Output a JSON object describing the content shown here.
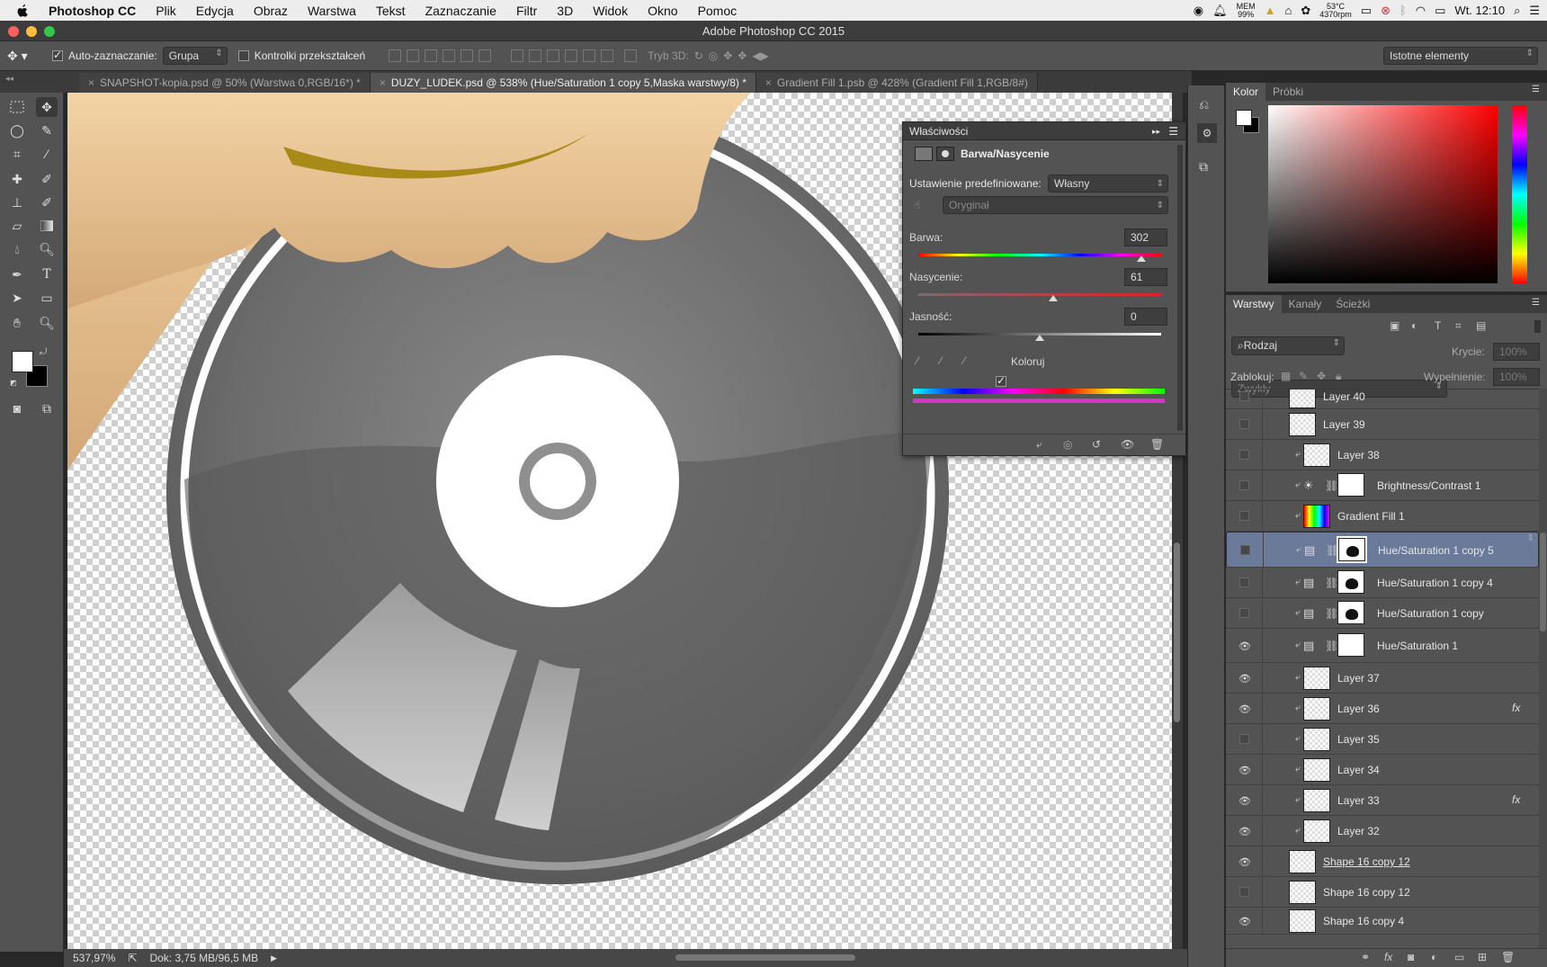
{
  "menubar": {
    "apple": "",
    "app_name": "Photoshop CC",
    "items": [
      "Plik",
      "Edycja",
      "Obraz",
      "Warstwa",
      "Tekst",
      "Zaznaczanie",
      "Filtr",
      "3D",
      "Widok",
      "Okno",
      "Pomoc"
    ],
    "mem_label": "MEM",
    "mem_value": "99%",
    "temp": "53°C",
    "rpm": "4370rpm",
    "clock": "Wt. 12:10"
  },
  "window": {
    "title": "Adobe Photoshop CC 2015"
  },
  "options": {
    "auto_select_label": "Auto-zaznaczanie:",
    "auto_select_value": "Grupa",
    "transform_controls_label": "Kontrolki przekształceń",
    "mode_3d_label": "Tryb 3D:",
    "workspace": "Istotne elementy"
  },
  "tabs": [
    {
      "label": "SNAPSHOT-kopia.psd @ 50% (Warstwa 0,RGB/16*) *",
      "active": false
    },
    {
      "label": "DUZY_LUDEK.psd @ 538% (Hue/Saturation 1 copy 5,Maska warstwy/8) *",
      "active": true
    },
    {
      "label": "Gradient Fill 1.psb @ 428% (Gradient Fill 1,RGB/8#)",
      "active": false
    }
  ],
  "status": {
    "zoom": "537,97%",
    "doc": "Dok: 3,75 MB/96,5 MB"
  },
  "properties": {
    "title": "Właściwości",
    "adjustment_name": "Barwa/Nasycenie",
    "preset_label": "Ustawienie predefiniowane:",
    "preset_value": "Własny",
    "channel_value": "Oryginał",
    "hue_label": "Barwa:",
    "hue_value": "302",
    "saturation_label": "Nasycenie:",
    "saturation_value": "61",
    "lightness_label": "Jasność:",
    "lightness_value": "0",
    "colorize_label": "Koloruj",
    "colorize_checked": true,
    "hue_fraction": 0.919,
    "saturation_fraction": 0.555,
    "lightness_fraction": 0.5
  },
  "color_panel": {
    "tabs": [
      "Kolor",
      "Próbki"
    ]
  },
  "layers_panel": {
    "tabs": [
      "Warstwy",
      "Kanały",
      "Ścieżki"
    ],
    "filter_value": "Rodzaj",
    "blend_mode": "Zwykły",
    "opacity_label": "Krycie:",
    "opacity_value": "100%",
    "lock_label": "Zablokuj:",
    "fill_label": "Wypełnienie:",
    "fill_value": "100%",
    "layers": [
      {
        "name": "Layer 40",
        "visible": false,
        "clipped": false,
        "kind": "pixel",
        "selected": false,
        "fx": false
      },
      {
        "name": "Layer 39",
        "visible": false,
        "clipped": false,
        "kind": "smart",
        "selected": false,
        "fx": false
      },
      {
        "name": "Layer 38",
        "visible": false,
        "clipped": true,
        "kind": "pixel",
        "selected": false,
        "fx": false
      },
      {
        "name": "Brightness/Contrast 1",
        "visible": false,
        "clipped": true,
        "kind": "brightness",
        "selected": false,
        "fx": false
      },
      {
        "name": "Gradient Fill 1",
        "visible": false,
        "clipped": true,
        "kind": "gradient",
        "selected": false,
        "fx": false
      },
      {
        "name": "Hue/Saturation 1 copy 5",
        "visible": false,
        "clipped": true,
        "kind": "huesat",
        "selected": true,
        "fx": false
      },
      {
        "name": "Hue/Saturation 1 copy 4",
        "visible": false,
        "clipped": true,
        "kind": "huesat",
        "selected": false,
        "fx": false
      },
      {
        "name": "Hue/Saturation 1 copy",
        "visible": false,
        "clipped": true,
        "kind": "huesat",
        "selected": false,
        "fx": false
      },
      {
        "name": "Hue/Saturation 1",
        "visible": true,
        "clipped": true,
        "kind": "huesat",
        "selected": false,
        "fx": false
      },
      {
        "name": "Layer 37",
        "visible": true,
        "clipped": true,
        "kind": "pixel",
        "selected": false,
        "fx": false
      },
      {
        "name": "Layer 36",
        "visible": true,
        "clipped": true,
        "kind": "pixel",
        "selected": false,
        "fx": true
      },
      {
        "name": "Layer 35",
        "visible": false,
        "clipped": true,
        "kind": "pixel",
        "selected": false,
        "fx": false
      },
      {
        "name": "Layer 34",
        "visible": true,
        "clipped": true,
        "kind": "pixel",
        "selected": false,
        "fx": false
      },
      {
        "name": "Layer 33",
        "visible": true,
        "clipped": true,
        "kind": "pixel",
        "selected": false,
        "fx": true
      },
      {
        "name": "Layer 32",
        "visible": true,
        "clipped": true,
        "kind": "pixel",
        "selected": false,
        "fx": false
      },
      {
        "name": "Shape 16 copy 12",
        "visible": true,
        "clipped": false,
        "kind": "smart",
        "selected": false,
        "fx": false
      },
      {
        "name": "Shape 16 copy 12",
        "visible": false,
        "clipped": false,
        "kind": "smart",
        "selected": false,
        "fx": false
      },
      {
        "name": "Shape 16 copy 4",
        "visible": true,
        "clipped": false,
        "kind": "smart",
        "selected": false,
        "fx": false
      }
    ]
  }
}
